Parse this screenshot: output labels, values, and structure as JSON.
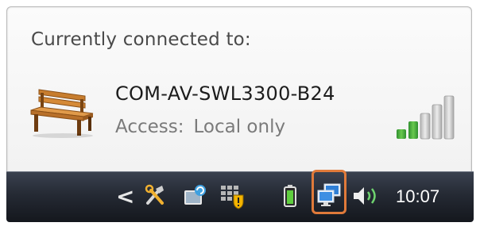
{
  "popup": {
    "heading": "Currently connected to:",
    "connection": {
      "name": "COM-AV-SWL3300-B24",
      "access_label": "Access:",
      "access_value": "Local only",
      "icon": "park-bench-icon",
      "signal_bars_filled": 2,
      "signal_bars_total": 5
    }
  },
  "taskbar": {
    "show_hidden_icon": "<",
    "clock": "10:07",
    "tray_icons": [
      "tools-icon",
      "update-icon",
      "security-shield-icon",
      "battery-icon",
      "network-icon",
      "volume-icon"
    ],
    "highlighted_icon": "network-icon",
    "colors": {
      "highlight": "#e07a3a",
      "signal_on": "#3aa33a"
    }
  }
}
